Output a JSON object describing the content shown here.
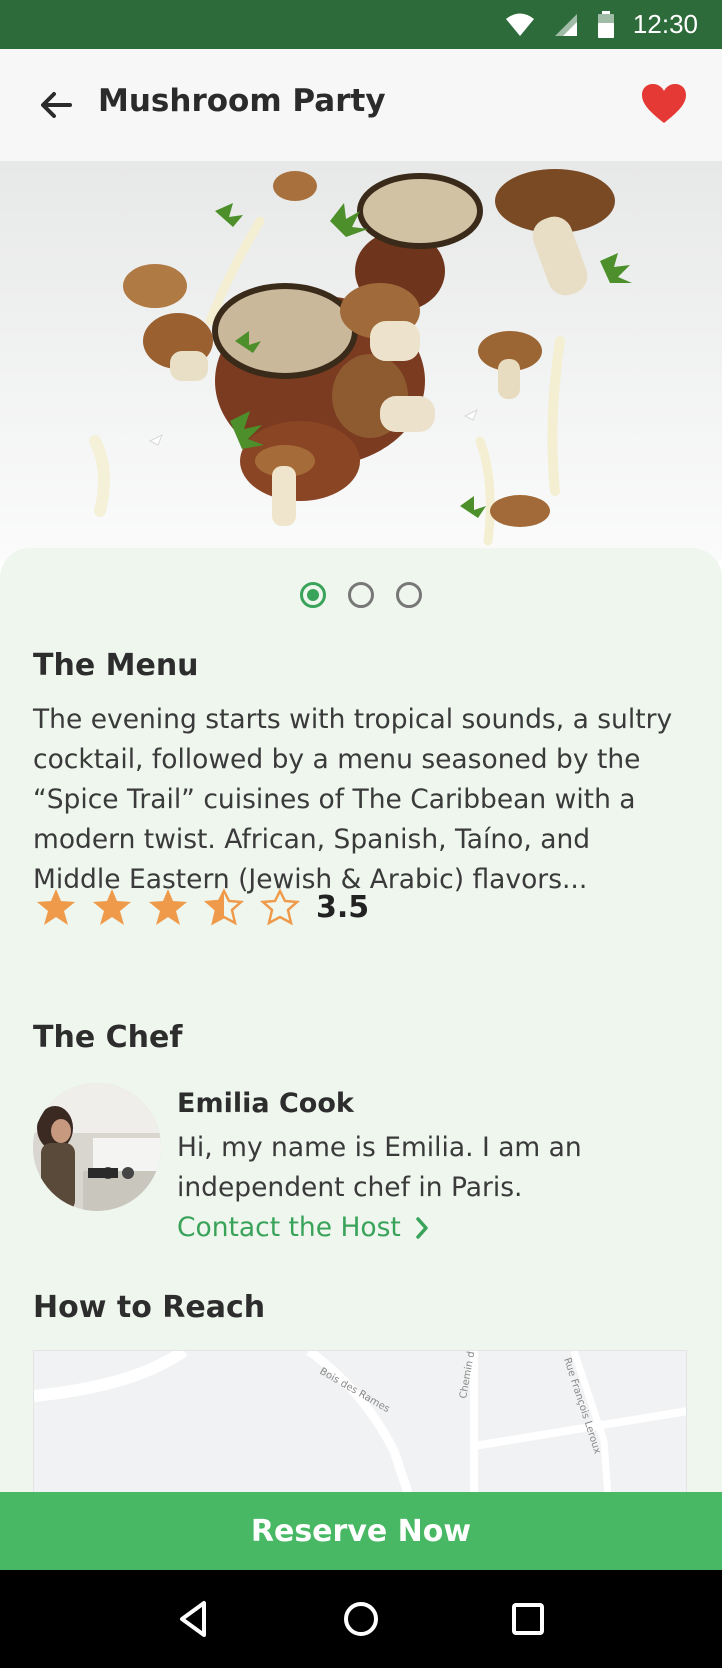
{
  "status_bar": {
    "time": "12:30",
    "icons": [
      "wifi-icon",
      "signal-icon",
      "battery-icon"
    ]
  },
  "app_bar": {
    "title": "Mushroom Party",
    "back_icon": "arrow-left-icon",
    "favorite_icon": "heart-icon",
    "favorite_color": "#e53935"
  },
  "gallery": {
    "total": 3,
    "active_index": 0
  },
  "menu": {
    "heading": "The Menu",
    "description": "The evening starts with tropical sounds, a sultry cocktail, followed by a menu seasoned by the “Spice Trail” cuisines of The Caribbean with a modern twist. African, Spanish, Taíno, and Middle Eastern (Jewish & Arabic) flavors..."
  },
  "rating": {
    "value": "3.5",
    "stars_out_of": 5,
    "star_color": "#ef9a4a"
  },
  "chef": {
    "heading": "The Chef",
    "name": "Emilia Cook",
    "bio": "Hi, my name is Emilia. I am an independent chef in Paris.",
    "contact_label": "Contact the Host"
  },
  "reach": {
    "heading": "How to Reach",
    "map_labels": [
      "Bois des Rames",
      "Chemin du",
      "Rue François Leroux"
    ]
  },
  "cta": {
    "label": "Reserve Now",
    "color": "#48b864"
  },
  "nav": [
    "back-triangle-icon",
    "home-circle-icon",
    "recents-square-icon"
  ],
  "colors": {
    "accent": "#3aa35a",
    "status_bar": "#2e6b3a",
    "sheet_bg": "#eef6ee"
  }
}
